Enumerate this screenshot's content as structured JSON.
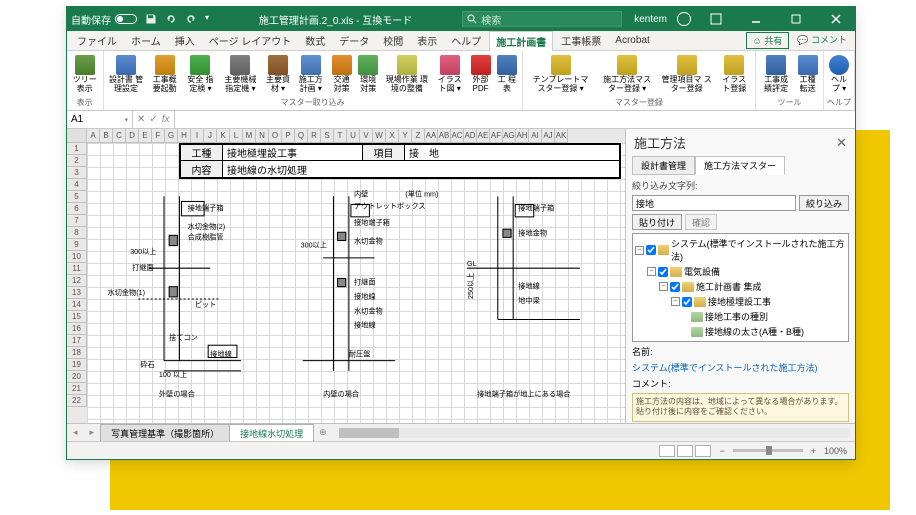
{
  "titlebar": {
    "autosave": "自動保存",
    "autosave_state": "オフ",
    "filename": "施工管理計画.2_0.xls - 互換モード",
    "search_placeholder": "検索",
    "user": "kentem"
  },
  "ribbon_tabs": [
    "ファイル",
    "ホーム",
    "挿入",
    "ページ レイアウト",
    "数式",
    "データ",
    "校閲",
    "表示",
    "ヘルプ",
    "施工計画書",
    "工事帳票",
    "Acrobat"
  ],
  "ribbon_active": 9,
  "share": "共有",
  "comments": "コメント",
  "ribbon_groups": {
    "g1": {
      "label": "表示",
      "items": [
        "ツリー\n表示"
      ]
    },
    "g2": {
      "label": "マスター取り込み",
      "items": [
        "設計書\n管理設定",
        "工事概\n要起動",
        "安全\n指定検 ▾",
        "主要機械\n指定機 ▾",
        "主要資\n材 ▾",
        "施工方\n計画 ▾",
        "交通\n対策",
        "環境\n対策",
        "現場作業\n環境の整備",
        "イラス\nト図 ▾",
        "外部\nPDF",
        "工\n程表"
      ]
    },
    "g3": {
      "label": "マスター登録",
      "items": [
        "テンプレートマ\nスター登録 ▾",
        "施工方法マス\nター登録 ▾",
        "管理項目マ\nスター登録",
        "イラス\nト登録"
      ]
    },
    "g4": {
      "label": "ツール",
      "items": [
        "工事成\n績評定",
        "工種\n転送"
      ]
    },
    "g5": {
      "label": "ヘルプ",
      "items": [
        "ヘル\nプ ▾"
      ]
    }
  },
  "namebox": "A1",
  "fx": "fx",
  "cols": [
    "A",
    "B",
    "C",
    "D",
    "E",
    "F",
    "G",
    "H",
    "I",
    "J",
    "K",
    "L",
    "M",
    "N",
    "O",
    "P",
    "Q",
    "R",
    "S",
    "T",
    "U",
    "V",
    "W",
    "X",
    "Y",
    "Z",
    "AA",
    "AB",
    "AC",
    "AD",
    "AE",
    "AF",
    "AG",
    "AH",
    "AI",
    "AJ",
    "AK"
  ],
  "rows": [
    "1",
    "2",
    "3",
    "4",
    "5",
    "6",
    "7",
    "8",
    "9",
    "10",
    "11",
    "12",
    "13",
    "14",
    "15",
    "16",
    "17",
    "18",
    "19",
    "20",
    "21",
    "22"
  ],
  "form": {
    "r1": {
      "lbl1": "工種",
      "val1": "接地極埋設工事",
      "lbl2": "項目",
      "val2": "接　地"
    },
    "r2": {
      "lbl1": "内容",
      "val1": "接地線の水切処理"
    }
  },
  "diagram": {
    "unit": "(単位  mm)",
    "labels": {
      "l1": "接地端子箱",
      "l2": "水切金物(2)",
      "l3": "合成樹脂管",
      "l4": "300以上",
      "l5": "打継面",
      "l6": "水切金物(1)",
      "l7": "ピット",
      "l8": "捨てコン",
      "l9": "砕石",
      "l10": "100\n以上",
      "l11": "接地線",
      "l12": "外壁の場合",
      "l13": "内壁",
      "l14": "アウトレットボックス",
      "l15": "接地端子箱",
      "l16": "300以上",
      "l17": "水切金物",
      "l18": "打継面",
      "l19": "接地線",
      "l20": "水切金物",
      "l21": "接地線",
      "l22": "耐圧盤",
      "l23": "内壁の場合",
      "l24": "接地端子箱",
      "l25": "接地金物",
      "l26": "GL",
      "l27": "250以上",
      "l28": "接地線",
      "l29": "地中梁",
      "l30": "接地端子箱が地上にある場合"
    }
  },
  "sheet_tabs": {
    "t1": "写真管理基準（撮影箇所）",
    "t2": "接地線水切処理"
  },
  "side": {
    "title": "施工方法",
    "tabs": [
      "設計書管理",
      "施工方法マスター"
    ],
    "filter_label": "絞り込み文字列:",
    "filter_value": "接地",
    "filter_btn": "絞り込み",
    "paste_btn": "貼り付け",
    "confirm_btn": "確認",
    "tree": {
      "n1": "システム(標準でインストールされた施工方法)",
      "n2": "電気設備",
      "n3": "施工計画書 集成",
      "n4": "接地極埋設工事",
      "n5": "接地工事の種別",
      "n6": "接地線の太さ(A種・B種)"
    },
    "name_label": "名前:",
    "name_value": "システム(標準でインストールされた施工方法)",
    "comment_label": "コメント:",
    "comment_text": "施工方法の内容は、地域によって異なる場合があります。貼り付け後に内容をご確認ください。"
  },
  "status": {
    "zoom": "100%"
  }
}
